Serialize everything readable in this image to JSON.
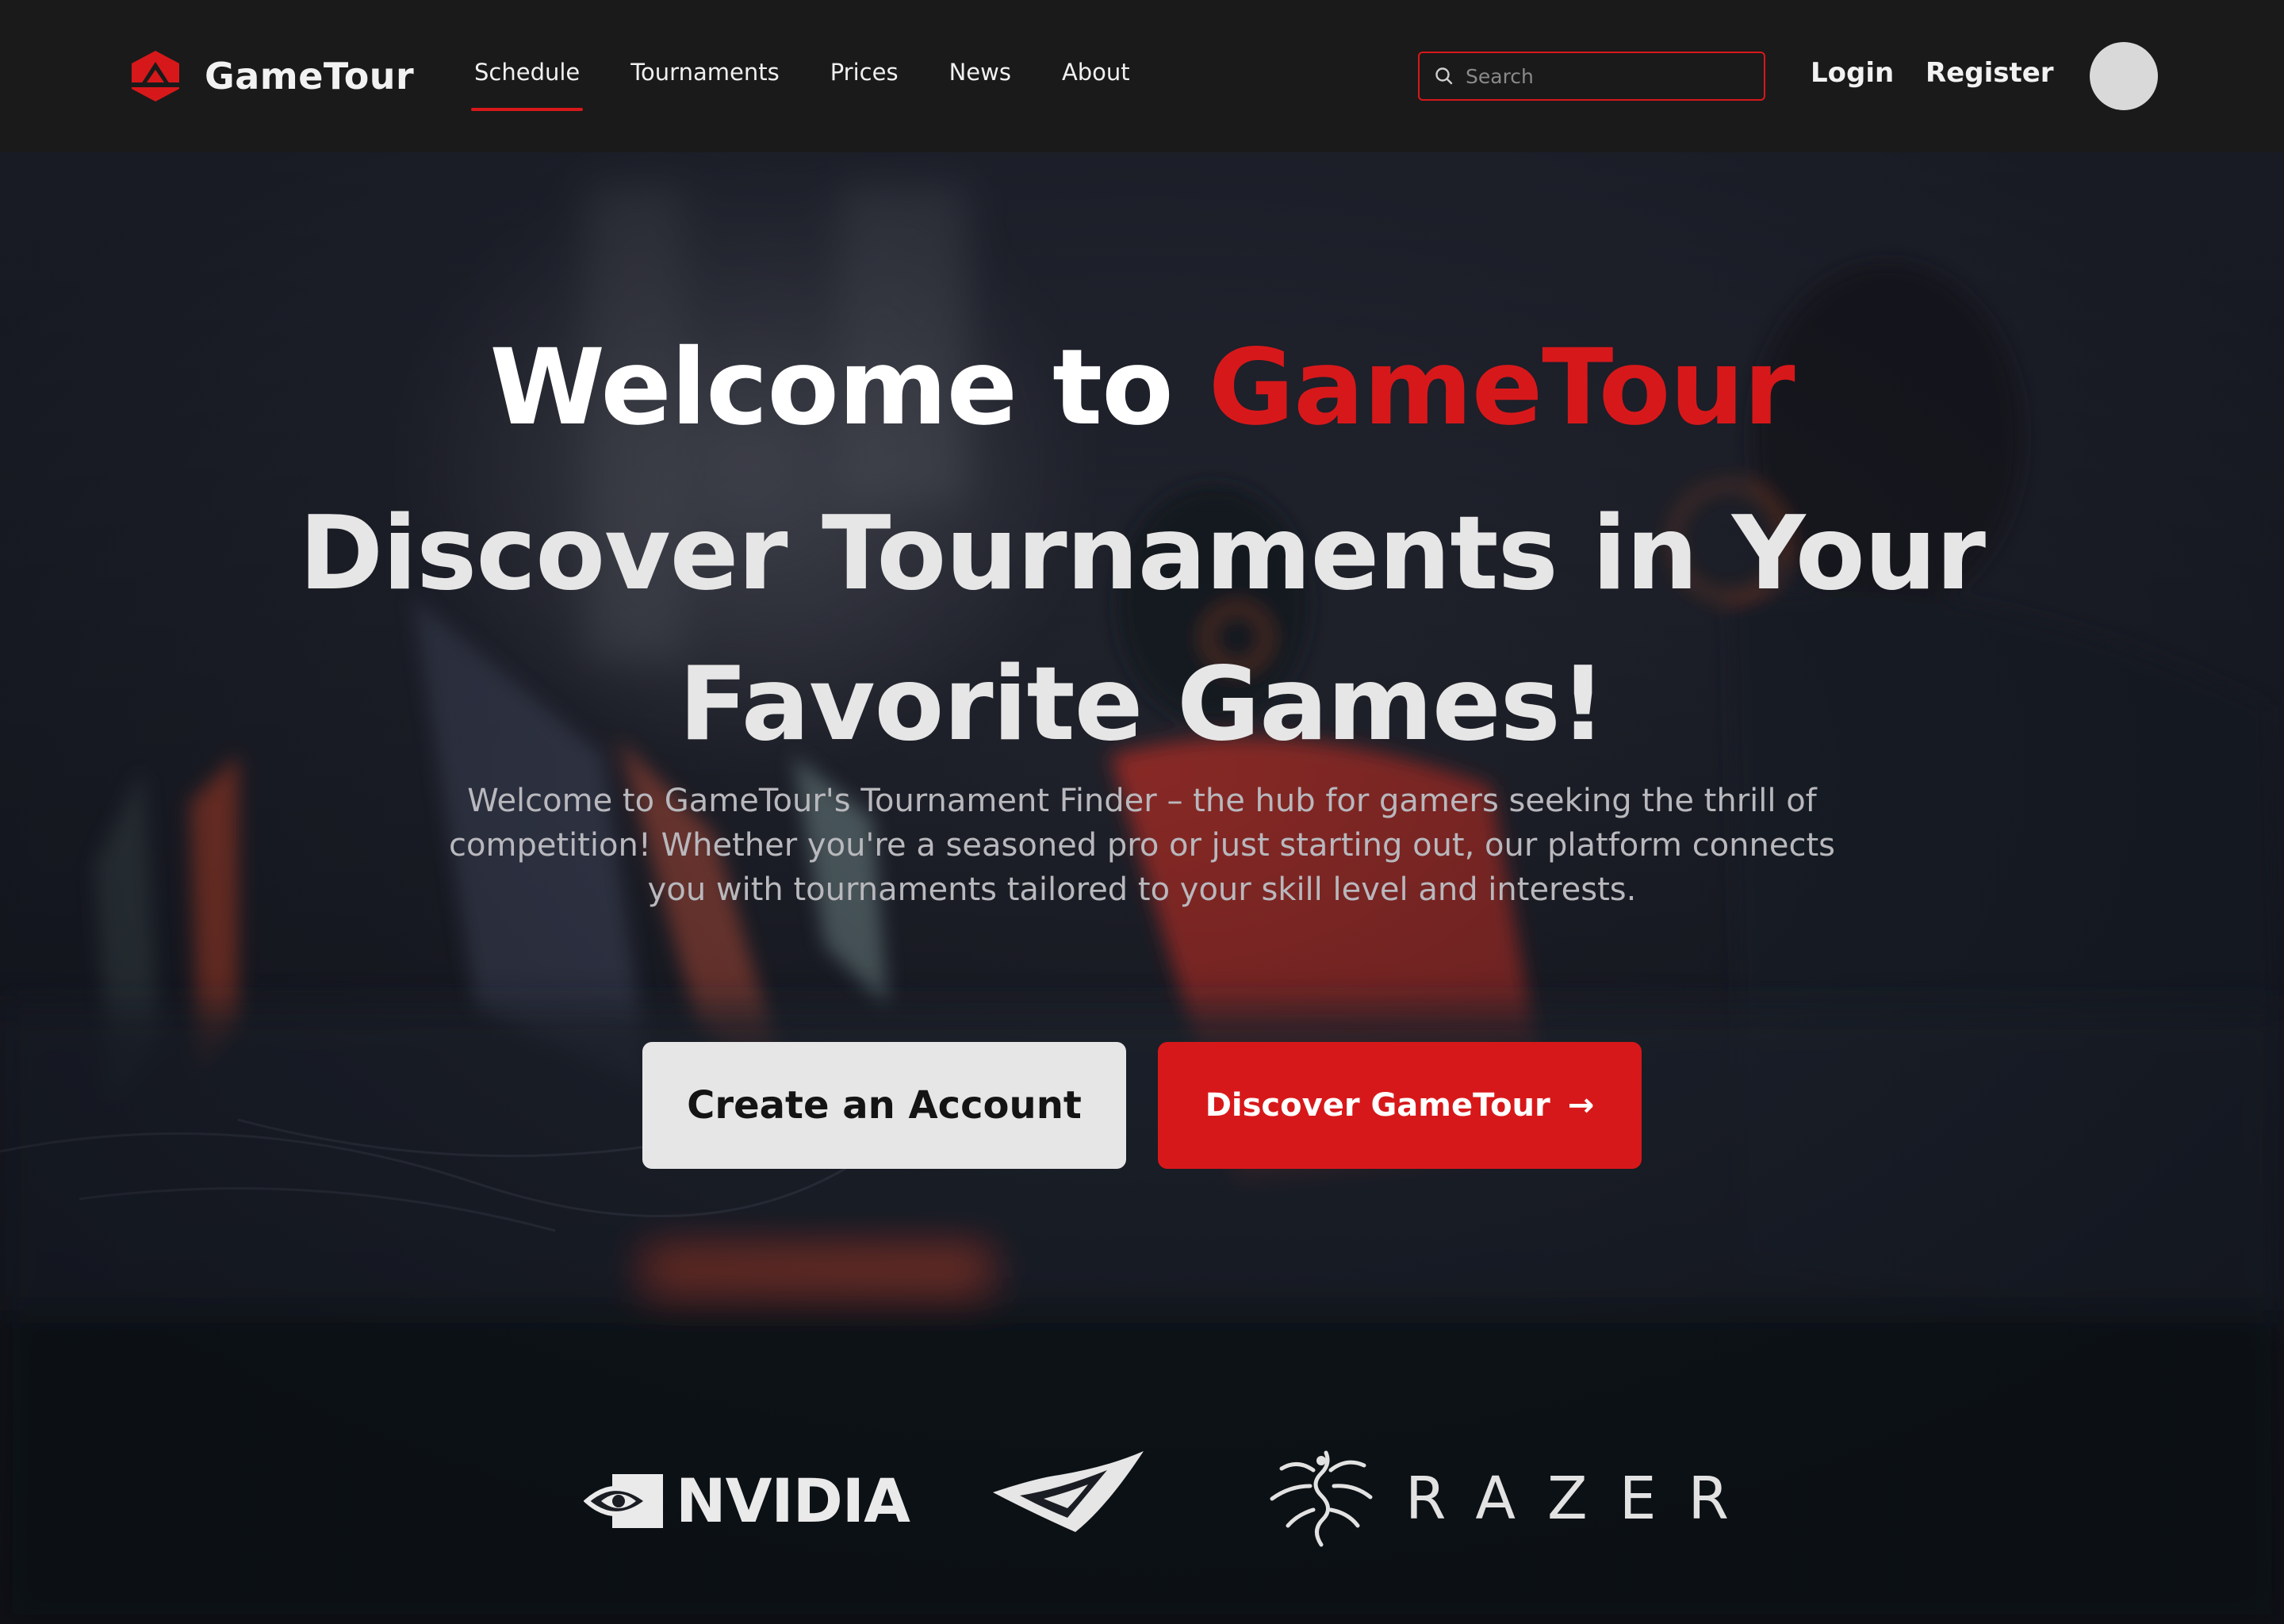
{
  "brand": {
    "name": "GameTour",
    "accent_color": "#d7181a"
  },
  "nav": {
    "links": [
      "Schedule",
      "Tournaments",
      "Prices",
      "News",
      "About"
    ],
    "active": "Schedule"
  },
  "search": {
    "placeholder": "Search"
  },
  "auth": {
    "login": "Login",
    "register": "Register"
  },
  "hero": {
    "title_prefix": "Welcome to ",
    "title_accent": "GameTour",
    "headline_line1": "Discover Tournaments in Your",
    "headline_line2": "Favorite Games!",
    "subtitle": "Welcome to GameTour's Tournament Finder – the hub for gamers seeking the thrill of competition! Whether you're a seasoned pro or just starting out, our platform connects you with tournaments tailored to your skill level and interests.",
    "primary_button": "Create an Account",
    "secondary_button": "Discover GameTour",
    "secondary_arrow": "→"
  },
  "sponsors": {
    "nvidia": "NVIDIA",
    "rog": "rog-logo",
    "razer": "RAZER"
  }
}
